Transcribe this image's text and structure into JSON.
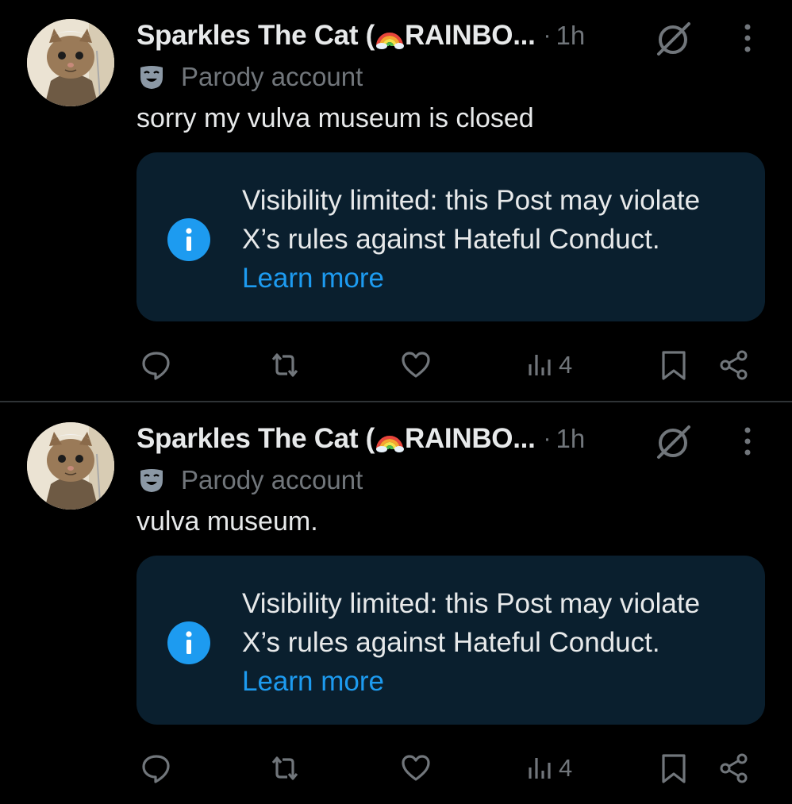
{
  "posts": [
    {
      "author": {
        "display_name": "Sparkles The Cat (",
        "name_suffix": "RAINBO...",
        "badge": "Parody account"
      },
      "time": "1h",
      "separator": "·",
      "text": "sorry my vulva museum is closed",
      "notice": {
        "message": "Visibility limited: this Post may violate X’s rules against Hateful Conduct.",
        "link": "Learn more"
      },
      "stats": {
        "views": "4"
      }
    },
    {
      "author": {
        "display_name": "Sparkles The Cat (",
        "name_suffix": "RAINBO...",
        "badge": "Parody account"
      },
      "time": "1h",
      "separator": "·",
      "text": "vulva museum.",
      "notice": {
        "message": "Visibility limited: this Post may violate X’s rules against Hateful Conduct.",
        "link": "Learn more"
      },
      "stats": {
        "views": "4"
      }
    }
  ],
  "icons": {
    "emoji": "rainbow-emoji",
    "badge": "parody-mask-icon",
    "grok": "grok-icon",
    "more": "more-vertical-icon",
    "info": "info-icon",
    "reply": "reply-icon",
    "repost": "repost-icon",
    "like": "like-icon",
    "views": "views-icon",
    "bookmark": "bookmark-icon",
    "share": "share-icon"
  },
  "colors": {
    "background": "#000000",
    "text": "#e7e9ea",
    "muted": "#71767b",
    "accent": "#1d9bf0",
    "notice_bg": "#0a1f2e",
    "divider": "#2f3336"
  }
}
